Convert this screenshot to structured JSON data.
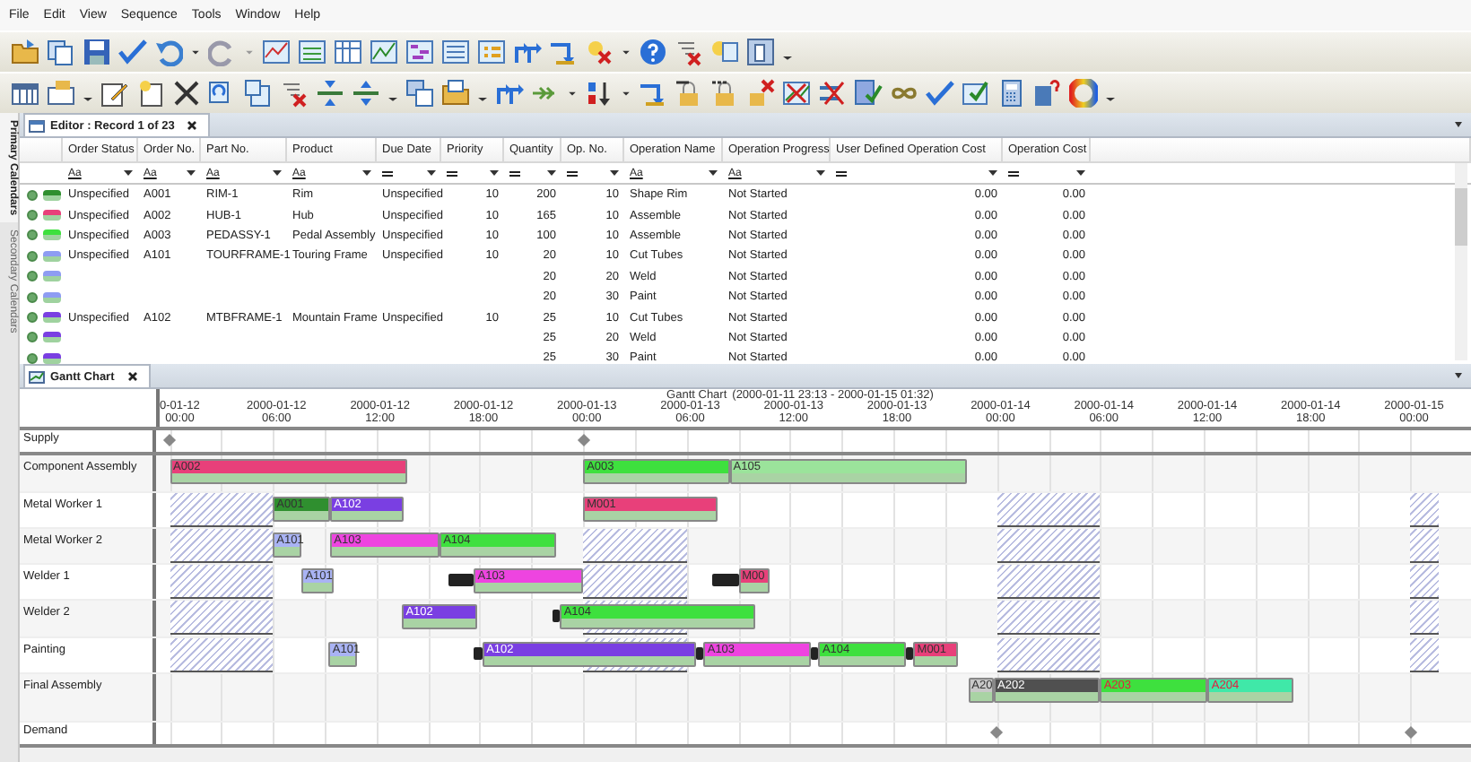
{
  "menu": [
    "File",
    "Edit",
    "View",
    "Sequence",
    "Tools",
    "Window",
    "Help"
  ],
  "side_tabs": [
    {
      "label": "Primary Calendars",
      "selected": true
    },
    {
      "label": "Secondary Calendars",
      "selected": false
    }
  ],
  "editor": {
    "tab": "Editor : Record 1 of 23",
    "columns": [
      {
        "label": "Order Status",
        "filter": {
          "kind": "text",
          "label": "Aa"
        }
      },
      {
        "label": "Order No.",
        "filter": {
          "kind": "text",
          "label": "Aa"
        }
      },
      {
        "label": "Part No.",
        "filter": {
          "kind": "text",
          "label": "Aa"
        }
      },
      {
        "label": "Product",
        "filter": {
          "kind": "text",
          "label": "Aa"
        }
      },
      {
        "label": "Due Date",
        "filter": {
          "kind": "number"
        }
      },
      {
        "label": "Priority",
        "filter": {
          "kind": "number"
        }
      },
      {
        "label": "Quantity",
        "filter": {
          "kind": "number"
        }
      },
      {
        "label": "Op. No.",
        "filter": {
          "kind": "number"
        }
      },
      {
        "label": "Operation Name",
        "filter": {
          "kind": "text",
          "label": "Aa"
        }
      },
      {
        "label": "Operation Progress",
        "filter": {
          "kind": "text",
          "label": "Aa"
        }
      },
      {
        "label": "User Defined Operation Cost",
        "filter": {
          "kind": "number"
        }
      },
      {
        "label": "Operation Cost",
        "filter": {
          "kind": "number"
        }
      }
    ],
    "rows": [
      {
        "color": "#2f8f2f",
        "cells": [
          "Unspecified",
          "A001",
          "RIM-1",
          "Rim",
          "Unspecified",
          "10",
          "200",
          "10",
          "Shape Rim",
          "Not Started",
          "0.00",
          "0.00"
        ]
      },
      {
        "color": "#e8407a",
        "cells": [
          "Unspecified",
          "A002",
          "HUB-1",
          "Hub",
          "Unspecified",
          "10",
          "165",
          "10",
          "Assemble",
          "Not Started",
          "0.00",
          "0.00"
        ]
      },
      {
        "color": "#3ee03e",
        "cells": [
          "Unspecified",
          "A003",
          "PEDASSY-1",
          "Pedal Assembly",
          "Unspecified",
          "10",
          "100",
          "10",
          "Assemble",
          "Not Started",
          "0.00",
          "0.00"
        ]
      },
      {
        "color": "#8e9cf2",
        "cells": [
          "Unspecified",
          "A101",
          "TOURFRAME-1",
          "Touring Frame",
          "Unspecified",
          "10",
          "20",
          "10",
          "Cut Tubes",
          "Not Started",
          "0.00",
          "0.00"
        ]
      },
      {
        "color": "#8e9cf2",
        "cells": [
          null,
          null,
          null,
          null,
          null,
          null,
          "20",
          "20",
          "Weld",
          "Not Started",
          "0.00",
          "0.00"
        ]
      },
      {
        "color": "#8e9cf2",
        "cells": [
          null,
          null,
          null,
          null,
          null,
          null,
          "20",
          "30",
          "Paint",
          "Not Started",
          "0.00",
          "0.00"
        ]
      },
      {
        "color": "#7a3fe2",
        "cells": [
          "Unspecified",
          "A102",
          "MTBFRAME-1",
          "Mountain Frame",
          "Unspecified",
          "10",
          "25",
          "10",
          "Cut Tubes",
          "Not Started",
          "0.00",
          "0.00"
        ]
      },
      {
        "color": "#7a3fe2",
        "cells": [
          null,
          null,
          null,
          null,
          null,
          null,
          "25",
          "20",
          "Weld",
          "Not Started",
          "0.00",
          "0.00"
        ]
      },
      {
        "color": "#7a3fe2",
        "cells": [
          null,
          null,
          null,
          null,
          null,
          null,
          "25",
          "30",
          "Paint",
          "Not Started",
          "0.00",
          "0.00"
        ]
      }
    ]
  },
  "gantt": {
    "tab": "Gantt Chart",
    "title": "Gantt Chart",
    "range_start": "(2000-01-11 23:13",
    "range_separator": " - ",
    "range_end": "2000-01-15 01:32)",
    "ticks": [
      {
        "date": "0-01-12",
        "time": "00:00"
      },
      {
        "date": "2000-01-12",
        "time": "06:00"
      },
      {
        "date": "2000-01-12",
        "time": "12:00"
      },
      {
        "date": "2000-01-12",
        "time": "18:00"
      },
      {
        "date": "2000-01-13",
        "time": "00:00"
      },
      {
        "date": "2000-01-13",
        "time": "06:00"
      },
      {
        "date": "2000-01-13",
        "time": "12:00"
      },
      {
        "date": "2000-01-13",
        "time": "18:00"
      },
      {
        "date": "2000-01-14",
        "time": "00:00"
      },
      {
        "date": "2000-01-14",
        "time": "06:00"
      },
      {
        "date": "2000-01-14",
        "time": "12:00"
      },
      {
        "date": "2000-01-14",
        "time": "18:00"
      },
      {
        "date": "2000-01-15",
        "time": "00:00"
      }
    ],
    "rows": [
      {
        "kind": "markers",
        "name": "Supply"
      },
      {
        "kind": "resource",
        "name": "Component Assembly",
        "bars": [
          {
            "kind": "operation",
            "label": "A002",
            "color": "#e8407a",
            "late": false
          },
          {
            "kind": "operation",
            "label": "A003",
            "color": "#3ee03e",
            "late": false
          },
          {
            "kind": "operation",
            "label": "A105",
            "color": "#9be39b",
            "late": false
          }
        ]
      },
      {
        "kind": "resource",
        "name": "Metal Worker 1",
        "bars": [
          {
            "kind": "operation",
            "label": "A001",
            "color": "#2f8f2f",
            "late": false
          },
          {
            "kind": "operation",
            "label": "A102",
            "color": "#7a3fe2",
            "late": false
          },
          {
            "kind": "operation",
            "label": "M001",
            "color": "#e8407a",
            "late": false
          }
        ]
      },
      {
        "kind": "resource",
        "name": "Metal Worker 2",
        "bars": [
          {
            "kind": "operation",
            "label": "A101",
            "color": "#a9b3f4",
            "late": false
          },
          {
            "kind": "operation",
            "label": "A103",
            "color": "#ee44e0",
            "late": false
          },
          {
            "kind": "operation",
            "label": "A104",
            "color": "#3ee03e",
            "late": false
          }
        ]
      },
      {
        "kind": "resource",
        "name": "Welder 1",
        "bars": [
          {
            "kind": "operation",
            "label": "A101",
            "color": "#a9b3f4",
            "late": false
          },
          {
            "kind": "setup"
          },
          {
            "kind": "operation",
            "label": "A103",
            "color": "#ee44e0",
            "late": false
          },
          {
            "kind": "setup"
          },
          {
            "kind": "operation",
            "label": "M00",
            "color": "#e8407a",
            "late": false
          }
        ]
      },
      {
        "kind": "resource",
        "name": "Welder 2",
        "bars": [
          {
            "kind": "operation",
            "label": "A102",
            "color": "#7a3fe2",
            "late": false
          },
          {
            "kind": "setup"
          },
          {
            "kind": "operation",
            "label": "A104",
            "color": "#3ee03e",
            "late": false
          }
        ]
      },
      {
        "kind": "resource",
        "name": "Painting",
        "bars": [
          {
            "kind": "operation",
            "label": "A101",
            "color": "#a9b3f4",
            "late": false
          },
          {
            "kind": "setup"
          },
          {
            "kind": "operation",
            "label": "A102",
            "color": "#7a3fe2",
            "late": false
          },
          {
            "kind": "setup"
          },
          {
            "kind": "operation",
            "label": "A103",
            "color": "#ee44e0",
            "late": false
          },
          {
            "kind": "setup"
          },
          {
            "kind": "operation",
            "label": "A104",
            "color": "#3ee03e",
            "late": false
          },
          {
            "kind": "setup"
          },
          {
            "kind": "operation",
            "label": "M001",
            "color": "#e8407a",
            "late": false
          }
        ]
      },
      {
        "kind": "resource",
        "name": "Final Assembly",
        "bars": [
          {
            "kind": "operation",
            "label": "A20",
            "color": "#c8c8c8",
            "late": false
          },
          {
            "kind": "operation",
            "label": "A202",
            "color": "#505050",
            "late": false
          },
          {
            "kind": "operation",
            "label": "A203",
            "color": "#3ee03e",
            "late": true
          },
          {
            "kind": "operation",
            "label": "A204",
            "color": "#40e8a8",
            "late": true
          }
        ]
      },
      {
        "kind": "markers",
        "name": "Demand"
      }
    ]
  }
}
